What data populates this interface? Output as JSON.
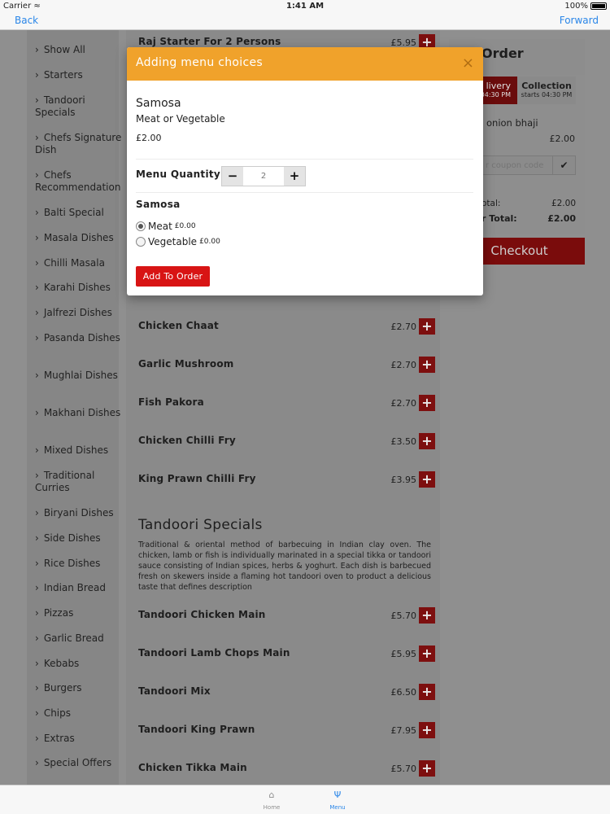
{
  "status": {
    "carrier": "Carrier",
    "time": "1:41 AM",
    "battery": "100%"
  },
  "nav": {
    "back": "Back",
    "forward": "Forward"
  },
  "sidebar": [
    "Show All",
    "Starters",
    "Tandoori Specials",
    "Chefs Signature Dish",
    "Chefs Recommendation",
    "Balti Special",
    "Masala Dishes",
    "Chilli Masala",
    "Karahi Dishes",
    "Jalfrezi Dishes",
    "Pasanda Dishes",
    "Mughlai Dishes",
    "Makhani Dishes",
    "Mixed Dishes",
    "Traditional Curries",
    "Biryani Dishes",
    "Side Dishes",
    "Rice Dishes",
    "Indian Bread",
    "Pizzas",
    "Garlic Bread",
    "Kebabs",
    "Burgers",
    "Chips",
    "Extras",
    "Special Offers"
  ],
  "menu_items": [
    {
      "name": "Raj Starter For 2 Persons",
      "price": "£5.95"
    },
    {
      "name": "Chicken Chaat",
      "price": "£2.70"
    },
    {
      "name": "Garlic Mushroom",
      "price": "£2.70"
    },
    {
      "name": "Fish Pakora",
      "price": "£2.70"
    },
    {
      "name": "Chicken Chilli Fry",
      "price": "£3.50"
    },
    {
      "name": "King Prawn Chilli Fry",
      "price": "£3.95"
    },
    {
      "name": "Tandoori Chicken Main",
      "price": "£5.70"
    },
    {
      "name": "Tandoori Lamb Chops Main",
      "price": "£5.95"
    },
    {
      "name": "Tandoori Mix",
      "price": "£6.50"
    },
    {
      "name": "Tandoori King Prawn",
      "price": "£7.95"
    },
    {
      "name": "Chicken Tikka Main",
      "price": "£5.70"
    }
  ],
  "section": {
    "title": "Tandoori Specials",
    "description": "Traditional & oriental method of barbecuing in Indian clay oven. The chicken, lamb or fish is individually marinated in a special tikka or tandoori sauce consisting of Indian spices, herbs & yoghurt. Each dish is barbecued fresh on skewers inside a flaming hot tandoori oven to product a delicious taste that defines description"
  },
  "order": {
    "title": "Order",
    "delivery_label": "livery",
    "delivery_sub": "s 04:30 PM",
    "collection_label": "Collection",
    "collection_sub": "starts 04:30 PM",
    "item": "onion bhaji",
    "item_price": "£2.00",
    "coupon_placeholder": "r coupon code",
    "subtotal_label": "otal:",
    "subtotal": "£2.00",
    "total_label": "r Total:",
    "total": "£2.00",
    "checkout": "Checkout"
  },
  "modal": {
    "title": "Adding menu choices",
    "close": "×",
    "item_name": "Samosa",
    "item_sub": "Meat or Vegetable",
    "item_price": "£2.00",
    "qty_label": "Menu Quantity",
    "qty_minus": "−",
    "qty_plus": "+",
    "qty_value": "2",
    "option_heading": "Samosa",
    "options": [
      {
        "label": "Meat",
        "price": "£0.00",
        "selected": true
      },
      {
        "label": "Vegetable",
        "price": "£0.00",
        "selected": false
      }
    ],
    "add_button": "Add To Order"
  },
  "tabbar": {
    "home": "Home",
    "menu": "Menu"
  },
  "colors": {
    "accent": "#f0a22b",
    "add_red": "#d81414",
    "link_blue": "#2a86e8"
  }
}
